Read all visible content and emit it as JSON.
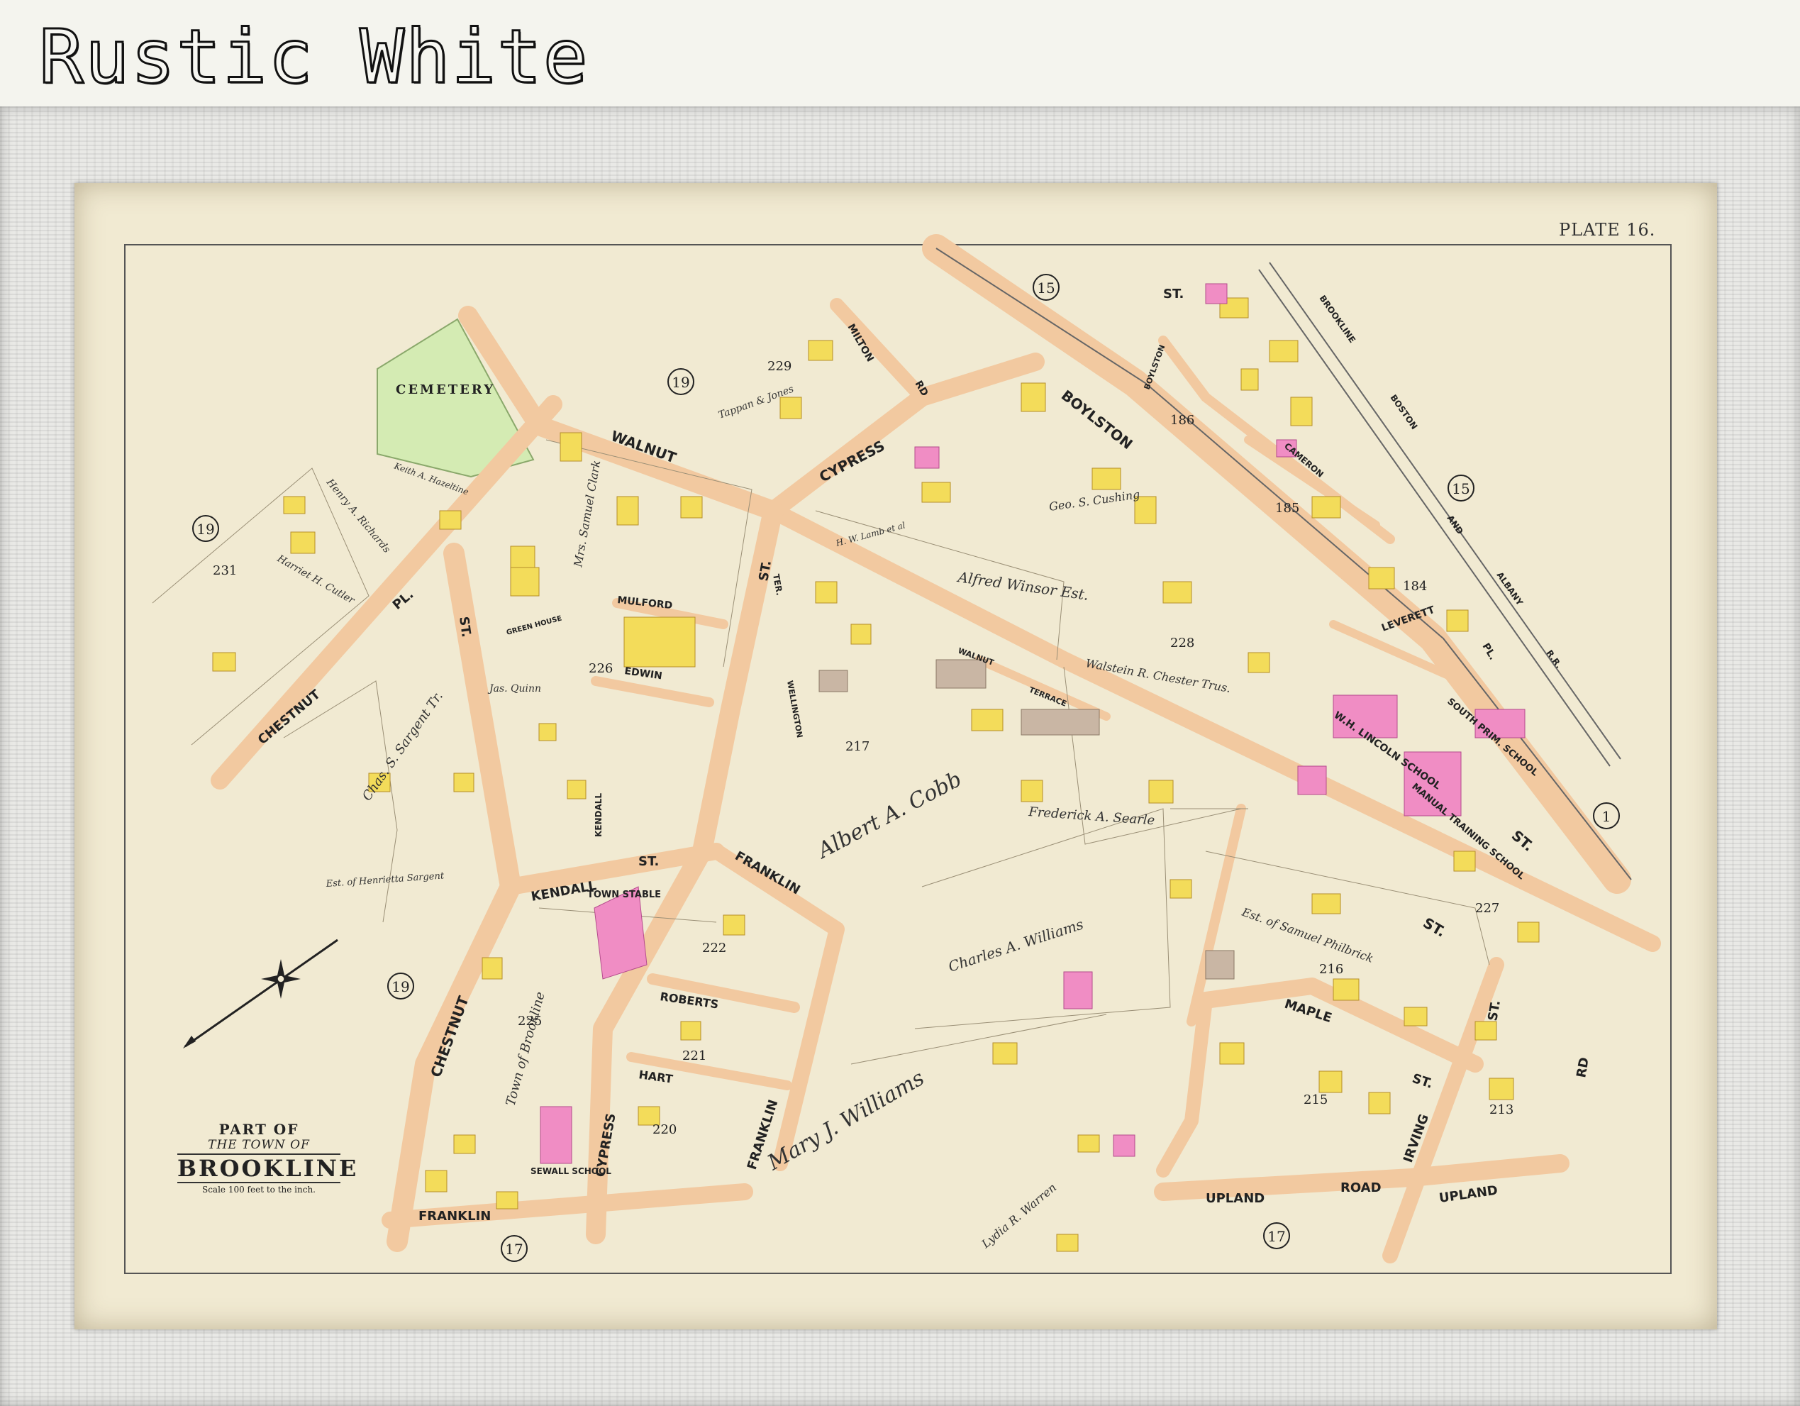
{
  "heading": "Rustic White",
  "plate": "PLATE 16.",
  "title": {
    "line1": "PART OF",
    "line2": "THE TOWN OF",
    "line3": "BROOKLINE",
    "scale": "Scale 100 feet to the inch."
  },
  "colors": {
    "paper": "#f1ead2",
    "road": "#f2c9a0",
    "building_yellow": "#f3dc5a",
    "building_pink": "#f08dc4",
    "building_gray": "#c9b6a4",
    "cemetery": "#d4ebb3",
    "frame": "#e9e9e6"
  },
  "streets": {
    "walnut": "WALNUT",
    "cypress_top": "CYPRESS",
    "boylston": "BOYLSTON",
    "st_top": "ST.",
    "milton": "MILTON",
    "rd": "RD",
    "chestnut_pl": "CHESTNUT",
    "pl": "PL.",
    "chestnut_st": "CHESTNUT",
    "st_chestnut": "ST.",
    "kendall": "KENDALL",
    "kendall_st": "ST.",
    "kendall_v": "KENDALL",
    "franklin_top": "FRANKLIN",
    "franklin_bottom": "FRANKLIN",
    "franklin_right": "FRANKLIN",
    "roberts": "ROBERTS",
    "hart": "HART",
    "cypress_bottom": "CYPRESS",
    "mulford": "MULFORD",
    "edwin": "EDWIN",
    "st_walnut_v": "ST.",
    "wellington": "WELLINGTON",
    "ter": "TER.",
    "walnut_small": "WALNUT",
    "terrace": "TERRACE",
    "cameron": "CAMERON",
    "boylston_pl": "BOYLSTON",
    "leverett": "LEVERETT",
    "pl_right": "PL.",
    "brookline": "BROOKLINE",
    "boston": "BOSTON",
    "and": "AND",
    "albany": "ALBANY",
    "rr": "R.R.",
    "maple": "MAPLE",
    "maple_st": "ST.",
    "upland_left": "UPLAND",
    "road": "ROAD",
    "upland_right": "UPLAND",
    "irving": "IRVING",
    "rd_right": "RD",
    "st_right": "ST.",
    "st_main": "ST.",
    "st_lower": "ST."
  },
  "wards": [
    "15",
    "19",
    "19",
    "19",
    "15",
    "19",
    "1",
    "17",
    "17"
  ],
  "blocks": [
    "229",
    "231",
    "226",
    "217",
    "228",
    "186",
    "185",
    "184",
    "227",
    "222",
    "221",
    "220",
    "225",
    "216",
    "215",
    "213"
  ],
  "landmarks": {
    "cemetery": "CEMETERY",
    "green_house": "GREEN HOUSE",
    "town_stable": "TOWN STABLE",
    "sewall_school": "SEWALL SCHOOL",
    "lincoln_school": "W.H. LINCOLN SCHOOL",
    "manual_training": "MANUAL TRAINING SCHOOL",
    "south_prim": "SOUTH PRIM. SCHOOL"
  },
  "owners": {
    "alfred_winsor": "Alfred Winsor Est.",
    "albert_cobb": "Albert A. Cobb",
    "charles_williams": "Charles A. Williams",
    "mary_williams": "Mary J. Williams",
    "frederick_searle": "Frederick A. Searle",
    "samuel_philbrick": "Est. of Samuel Philbrick",
    "geo_cushing": "Geo. S. Cushing",
    "walstein_chester": "Walstein R. Chester Trus.",
    "henrietta_sargent": "Est. of Henrietta Sargent",
    "chas_sargent": "Chas. S. Sargent Tr.",
    "samuel_clark": "Mrs. Samuel Clark",
    "jas_quinn": "Jas. Quinn",
    "lydia_warren": "Lydia R. Warren",
    "town_of_brookline": "Town of Brookline",
    "tappan": "Tappan & Jones",
    "h_w_lamb": "H. W. Lamb et al",
    "harriet_cutler": "Harriet H. Cutler",
    "henry_richards": "Henry A. Richards",
    "keith_hazeltine": "Keith A. Hazeltine"
  }
}
